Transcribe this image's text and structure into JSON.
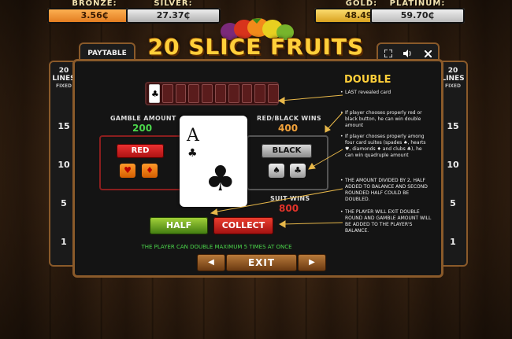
{
  "jackpots": [
    {
      "name": "BRONZE:",
      "value": "3.56₵"
    },
    {
      "name": "SILVER:",
      "value": "27.37₵"
    },
    {
      "name": "GOLD:",
      "value": "48.49₵"
    },
    {
      "name": "PLATINUM:",
      "value": "59.70₵"
    }
  ],
  "title": "20 SLICE FRUITS",
  "tabs": {
    "paytable": "PAYTABLE"
  },
  "controls": {
    "fullscreen_icon": "expand-icon",
    "sound_icon": "speaker-icon",
    "close_icon": "close-icon"
  },
  "lines_badge": {
    "count": "20",
    "lines": "LINES",
    "fixed": "FIXED"
  },
  "line_numbers": [
    "15",
    "10",
    "5",
    "1"
  ],
  "gamble": {
    "gamble_amount_label": "GAMBLE AMOUNT",
    "gamble_amount": "200",
    "red_black_label": "RED/BLACK WINS",
    "red_black_value": "400",
    "suit_wins_label": "SUIT WINS",
    "suit_wins_value": "800",
    "red_button": "RED",
    "black_button": "BLACK",
    "red_suits": [
      "♥",
      "♦"
    ],
    "black_suits": [
      "♠",
      "♣"
    ],
    "card_rank": "A",
    "card_suit": "♣",
    "deck_first_suit": "♣",
    "half_button": "HALF",
    "collect_button": "COLLECT",
    "notice": "THE PLAYER CAN DOUBLE MAXIMUM 5 TIMES AT ONCE"
  },
  "info": {
    "title": "DOUBLE",
    "notes": [
      "LAST revealed card",
      "If player chooses properly red or black button, he can win double amount",
      "If player chooses properly among four card suites (spades ♠, hearts ♥, diamonds ♦ and clubs ♣), he can win quadruple amount",
      "THE AMOUNT DIVIDED BY 2, HALF ADDED TO BALANCE AND SECOND ROUNDED HALF COULD BE DOUBLED.",
      "THE PLAYER WILL EXIT DOUBLE ROUND AND GAMBLE AMOUNT WILL BE ADDED TO THE PLAYER'S BALANCE."
    ]
  },
  "nav": {
    "prev": "◀",
    "exit": "EXIT",
    "next": "▶"
  },
  "colors": {
    "accent": "#ffcf3a",
    "green": "#4bd64b",
    "orange": "#f2a23a",
    "red": "#e3332a",
    "frame": "#8a5a2a"
  }
}
